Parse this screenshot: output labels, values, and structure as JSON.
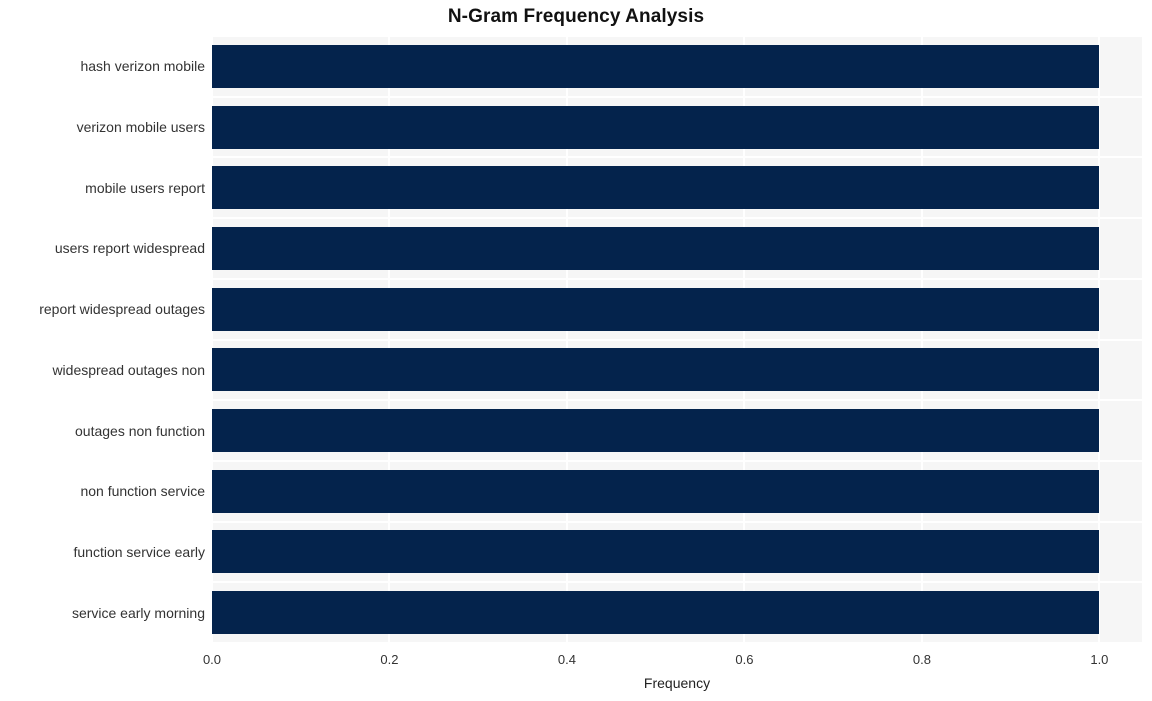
{
  "chart_data": {
    "type": "bar",
    "orientation": "horizontal",
    "title": "N-Gram Frequency Analysis",
    "xlabel": "Frequency",
    "ylabel": "",
    "categories": [
      "hash verizon mobile",
      "verizon mobile users",
      "mobile users report",
      "users report widespread",
      "report widespread outages",
      "widespread outages non",
      "outages non function",
      "non function service",
      "function service early",
      "service early morning"
    ],
    "values": [
      1.0,
      1.0,
      1.0,
      1.0,
      1.0,
      1.0,
      1.0,
      1.0,
      1.0,
      1.0
    ],
    "x_tick_labels": [
      "0.0",
      "0.2",
      "0.4",
      "0.6",
      "0.8",
      "1.0"
    ],
    "x_tick_values": [
      0.0,
      0.2,
      0.4,
      0.6,
      0.8,
      1.0
    ],
    "xlim": [
      0.0,
      1.048
    ],
    "grid": true,
    "legend": null,
    "bar_color": "#04234c",
    "plot_background": "#f6f6f6",
    "figure_background": "#ffffff",
    "gridline_color": "#ffffff",
    "text_color": "#333333"
  }
}
